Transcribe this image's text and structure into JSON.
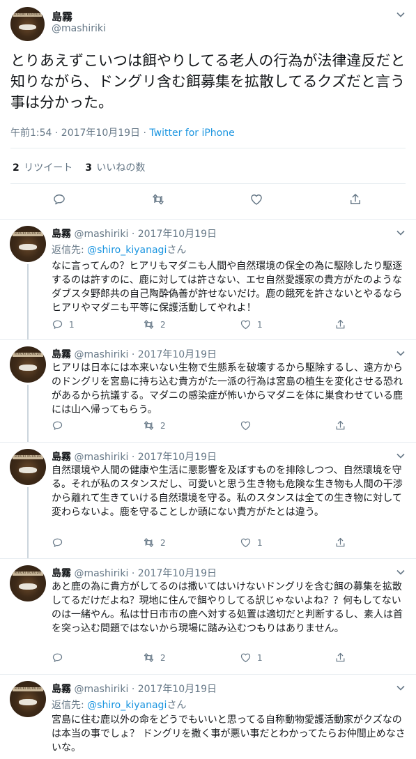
{
  "main": {
    "name": "島霧",
    "handle": "@mashiriki",
    "avatar_text": "HIROKI KURODA",
    "text": "とりあえずこいつは餌やりしてる老人の行為が法律違反だと知りながら、ドングリ含む餌募集を拡散してるクズだと言う事は分かった。",
    "time": "午前1:54 · 2017年10月19日 · ",
    "via": "Twitter for iPhone",
    "retweet_count": "2",
    "retweet_label": "リツイート",
    "like_count": "3",
    "like_label": "いいねの数"
  },
  "replies": [
    {
      "name": "島霧",
      "handle": "@mashiriki",
      "date": "· 2017年10月19日",
      "reply_to_label": "返信先: ",
      "reply_to_handle": "@shiro_kiyanagi",
      "reply_to_suffix": "さん",
      "text": "なに言ってんの？ヒアリもマダニも人間や自然環境の保全の為に駆除したり駆逐するのは許すのに、鹿に対しては許さない、エセ自然愛護家の貴方がたのようなダブスタ野郎共の自己陶酔偽善が許せないだけ。鹿の餓死を許さないとやるならヒアリやマダニも平等に保護活動してやれよ！",
      "replies": "1",
      "retweets": "2",
      "likes": "1"
    },
    {
      "name": "島霧",
      "handle": "@mashiriki",
      "date": "· 2017年10月19日",
      "text": "ヒアリは日本には本来いない生物で生態系を破壊するから駆除するし、遠方からのドングリを宮島に持ち込む貴方がた一派の行為は宮島の植生を変化させる恐れがあるから抗議する。マダニの感染症が怖いからマダニを体に巣食わせている鹿には山へ帰ってもらう。",
      "replies": "",
      "retweets": "2",
      "likes": ""
    },
    {
      "name": "島霧",
      "handle": "@mashiriki",
      "date": "· 2017年10月19日",
      "text": "自然環境や人間の健康や生活に悪影響を及ぼすものを排除しつつ、自然環境を守る。それが私のスタンスだし、可愛いと思う生き物も危険な生き物も人間の干渉から離れて生きていける自然環境を守る。私のスタンスは全ての生き物に対して変わらないよ。鹿を守ることしか頭にない貴方がたとは違う。",
      "replies": "",
      "retweets": "2",
      "likes": "1"
    },
    {
      "name": "島霧",
      "handle": "@mashiriki",
      "date": "· 2017年10月19日",
      "text": "あと鹿の為に貴方がしてるのは撒いてはいけないドングリを含む餌の募集を拡散してるだけだよね？現地に住んで餌やりしてる訳じゃないよね？？何もしてないのは一緒やん。私は廿日市市の鹿へ対する処置は適切だと判断するし、素人は首を突っ込む問題ではないから現場に踏み込むつもりはありません。",
      "replies": "",
      "retweets": "2",
      "likes": "1"
    },
    {
      "name": "島霧",
      "handle": "@mashiriki",
      "date": "· 2017年10月19日",
      "reply_to_label": "返信先: ",
      "reply_to_handle": "@shiro_kiyanagi",
      "reply_to_suffix": "さん",
      "text": "宮島に住む鹿以外の命をどうでもいいと思ってる自称動物愛護活動家がクズなのは本当の事でしょ？ ドングリを撒く事が悪い事だとわかってたらお仲間止めなさいな。"
    }
  ],
  "icons": [
    "chevron-down-icon",
    "reply-icon",
    "retweet-icon",
    "like-icon",
    "share-icon"
  ],
  "colors": {
    "link": "#1b95e0",
    "muted": "#657786",
    "text": "#14171a",
    "border": "#e6ecf0",
    "thread_line": "#ccd6dd"
  }
}
